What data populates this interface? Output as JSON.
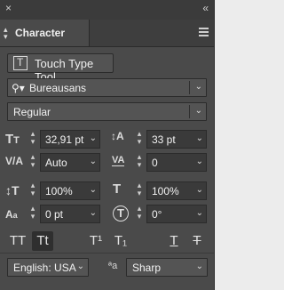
{
  "panel": {
    "close_glyph": "×",
    "collapse_glyph": "«",
    "tab_title": "Character"
  },
  "toolbar": {
    "touch_type_label": "Touch Type Tool"
  },
  "font": {
    "family": "Bureausans",
    "style": "Regular"
  },
  "fields": {
    "font_size": "32,91 pt",
    "leading": "33 pt",
    "kerning": "Auto",
    "tracking": "0",
    "vertical_scale": "100%",
    "horizontal_scale": "100%",
    "baseline_shift": "0 pt",
    "rotation": "0°"
  },
  "styles": {
    "all_caps": "TT",
    "small_caps": "Tt",
    "superscript": "T¹",
    "subscript": "T₁",
    "underline": "T",
    "strikethrough": "T"
  },
  "footer": {
    "language": "English: USA",
    "antialias": "Sharp"
  },
  "colors": {
    "panel_bg": "#4a4a4a",
    "field_bg": "#3a3a3a",
    "text": "#e6e6e6"
  }
}
